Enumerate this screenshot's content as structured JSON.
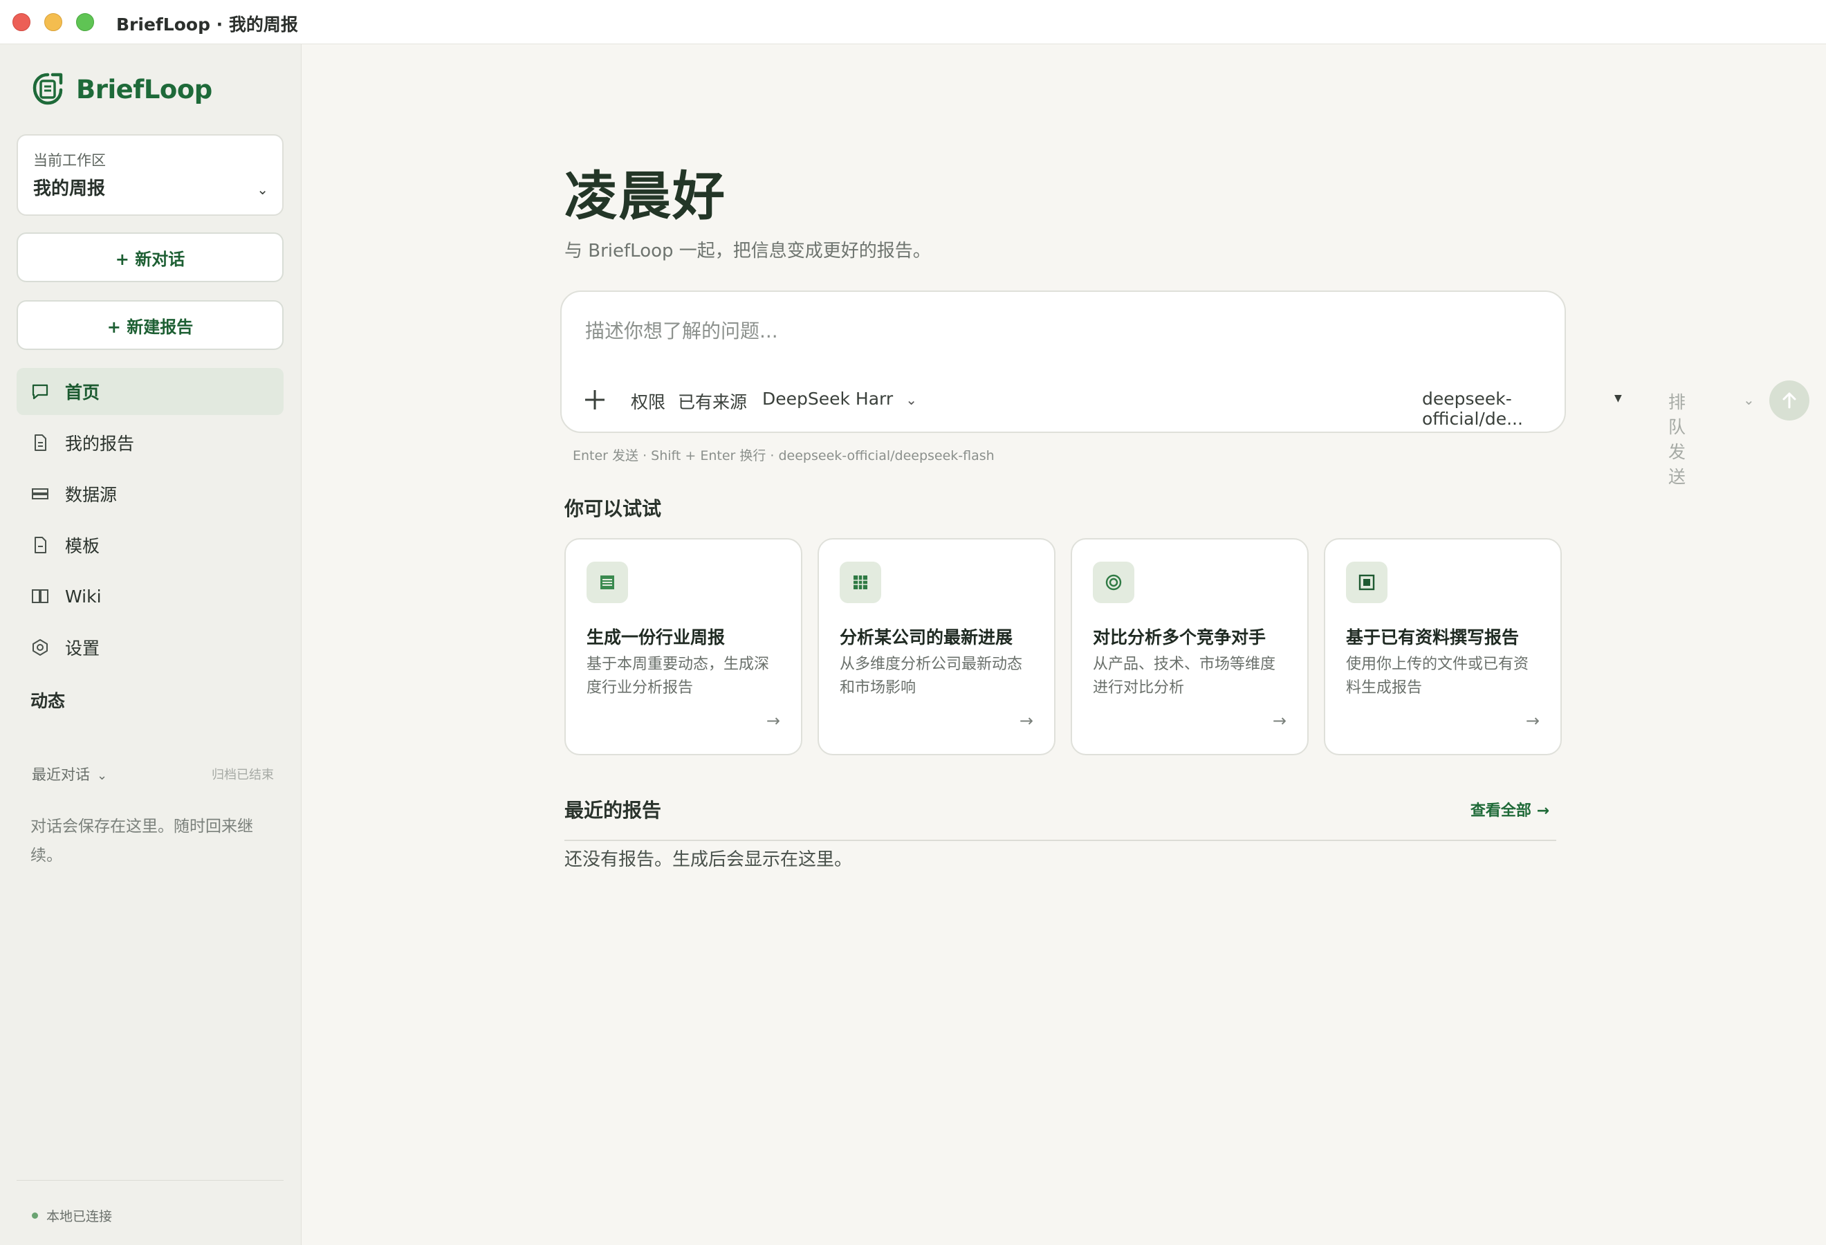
{
  "window": {
    "title": "BriefLoop · 我的周报"
  },
  "brand": {
    "name": "BriefLoop",
    "color": "#1e6a39"
  },
  "sidebar": {
    "workspace": {
      "label": "当前工作区",
      "name": "我的周报"
    },
    "new_chat": "+ 新对话",
    "new_report": "+ 新建报告",
    "nav": [
      {
        "label": "首页",
        "icon": "chat-bubble-icon",
        "active": true
      },
      {
        "label": "我的报告",
        "icon": "document-icon"
      },
      {
        "label": "数据源",
        "icon": "database-icon"
      },
      {
        "label": "模板",
        "icon": "template-icon"
      },
      {
        "label": "Wiki",
        "icon": "book-icon"
      },
      {
        "label": "设置",
        "icon": "gear-icon"
      }
    ],
    "section_activity": "动态",
    "recent": {
      "label": "最近对话",
      "archive": "归档已结束",
      "empty": "对话会保存在这里。随时回来继续。"
    },
    "status": "本地已连接"
  },
  "main": {
    "greeting": "凌晨好",
    "subtitle": "与 BriefLoop 一起，把信息变成更好的报告。",
    "composer": {
      "placeholder": "描述你想了解的问题...",
      "tool_permissions": "权限",
      "tool_sources": "已有来源",
      "tool_agent": "DeepSeek Harr",
      "model": "deepseek-official/de...",
      "queue_send": "排队发送"
    },
    "hint": "Enter 发送 · Shift + Enter 换行 · deepseek-official/deepseek-flash",
    "suggest_title": "你可以试试",
    "cards": [
      {
        "title": "生成一份行业周报",
        "desc": "基于本周重要动态，生成深度行业分析报告",
        "icon": "list-doc-icon"
      },
      {
        "title": "分析某公司的最新进展",
        "desc": "从多维度分析公司最新动态和市场影响",
        "icon": "grid-icon"
      },
      {
        "title": "对比分析多个竞争对手",
        "desc": "从产品、技术、市场等维度进行对比分析",
        "icon": "target-icon"
      },
      {
        "title": "基于已有资料撰写报告",
        "desc": "使用你上传的文件或已有资料生成报告",
        "icon": "square-doc-icon"
      }
    ],
    "reports": {
      "title": "最近的报告",
      "view_all": "查看全部 →",
      "empty": "还没有报告。生成后会显示在这里。"
    }
  }
}
